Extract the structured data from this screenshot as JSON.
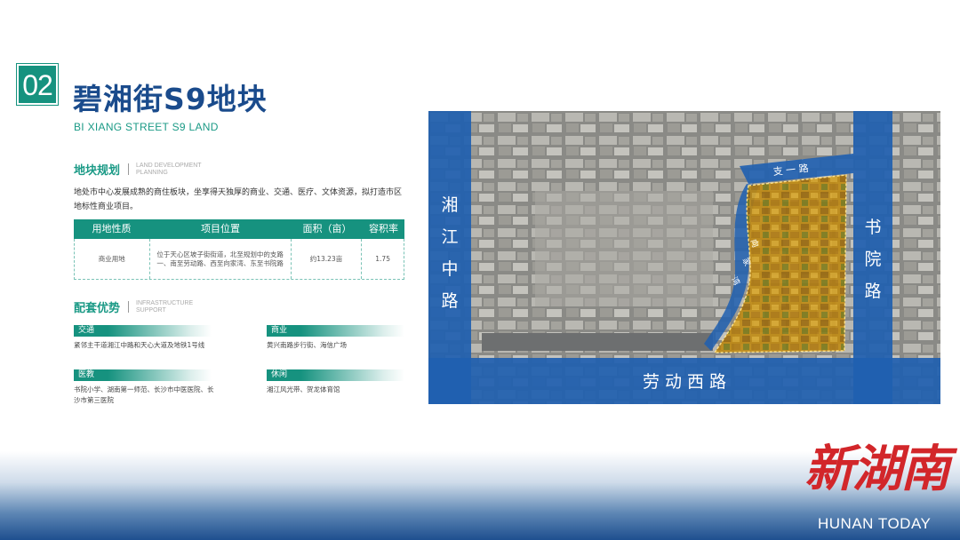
{
  "badge": {
    "number": "02"
  },
  "title": {
    "zh": "碧湘街S9地块",
    "en": "BI XIANG STREET S9 LAND"
  },
  "land_planning": {
    "heading_zh": "地块规划",
    "heading_en_line1": "LAND DEVELOPMENT",
    "heading_en_line2": "PLANNING",
    "description": "地处市中心发展成熟的商住板块，坐享得天独厚的商业、交通、医疗、文体资源，拟打造市区地标性商业项目。"
  },
  "table": {
    "headers": [
      "用地性质",
      "项目位置",
      "面积（亩）",
      "容积率"
    ],
    "rows": [
      [
        "商业用地",
        "位于天心区坡子街街道，北至规划中的支路一、南至劳动路、西至向家湾、东至书院路",
        "约13.23亩",
        "1.75"
      ]
    ]
  },
  "advantages": {
    "heading_zh": "配套优势",
    "heading_en_line1": "INFRASTRUCTURE",
    "heading_en_line2": "SUPPORT",
    "items": [
      {
        "label": "交通",
        "text": "紧邻主干道湘江中路和天心大道及地铁1号线"
      },
      {
        "label": "商业",
        "text": "黄兴南路步行街、海信广场"
      },
      {
        "label": "医教",
        "text": "书院小学、湖南第一师范、长沙市中医医院、长沙市第三医院"
      },
      {
        "label": "休闲",
        "text": "湘江风光带、贺龙体育馆"
      }
    ]
  },
  "map": {
    "roads": {
      "west": [
        "湘",
        "江",
        "中",
        "路"
      ],
      "east": [
        "书",
        "院",
        "路"
      ],
      "south": "劳 动 西 路",
      "north": "支 一 路",
      "inner": [
        "向",
        "家",
        "湾"
      ]
    },
    "colors": {
      "road": "#1f5fb0",
      "parcel": "#d39a16",
      "boundary": "#ffe28a"
    }
  },
  "logo": {
    "zh": "新湖南",
    "en": "HUNAN TODAY"
  },
  "colors": {
    "accent": "#16927f",
    "title": "#1a4b8c",
    "logo": "#d2262a"
  }
}
